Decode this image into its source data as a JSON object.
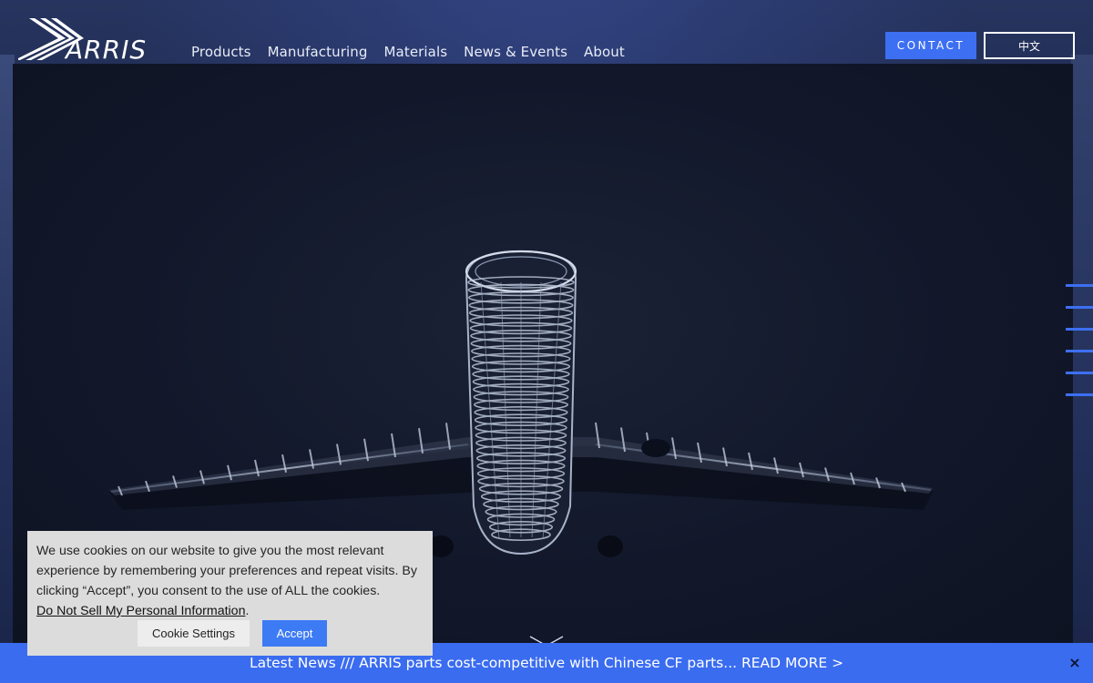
{
  "brand": {
    "name": "ARRIS",
    "accent": "#3d6ff2"
  },
  "header": {
    "nav": [
      "Products",
      "Manufacturing",
      "Materials",
      "News & Events",
      "About"
    ],
    "contact_label": "CONTACT",
    "lang_label": "中文"
  },
  "hero": {
    "image": "airplane-wireframe-render",
    "slides": 6
  },
  "cookie": {
    "text": "We use cookies on our website to give you the most relevant experience by remembering your preferences and repeat visits. By clicking “Accept”, you consent to the use of ALL the cookies.",
    "link_label": "Do Not Sell My Personal Information",
    "settings_label": "Cookie Settings",
    "accept_label": "Accept"
  },
  "news": {
    "text": "Latest News /// ARRIS parts cost-competitive with Chinese CF parts... READ MORE >",
    "close_label": "×"
  }
}
